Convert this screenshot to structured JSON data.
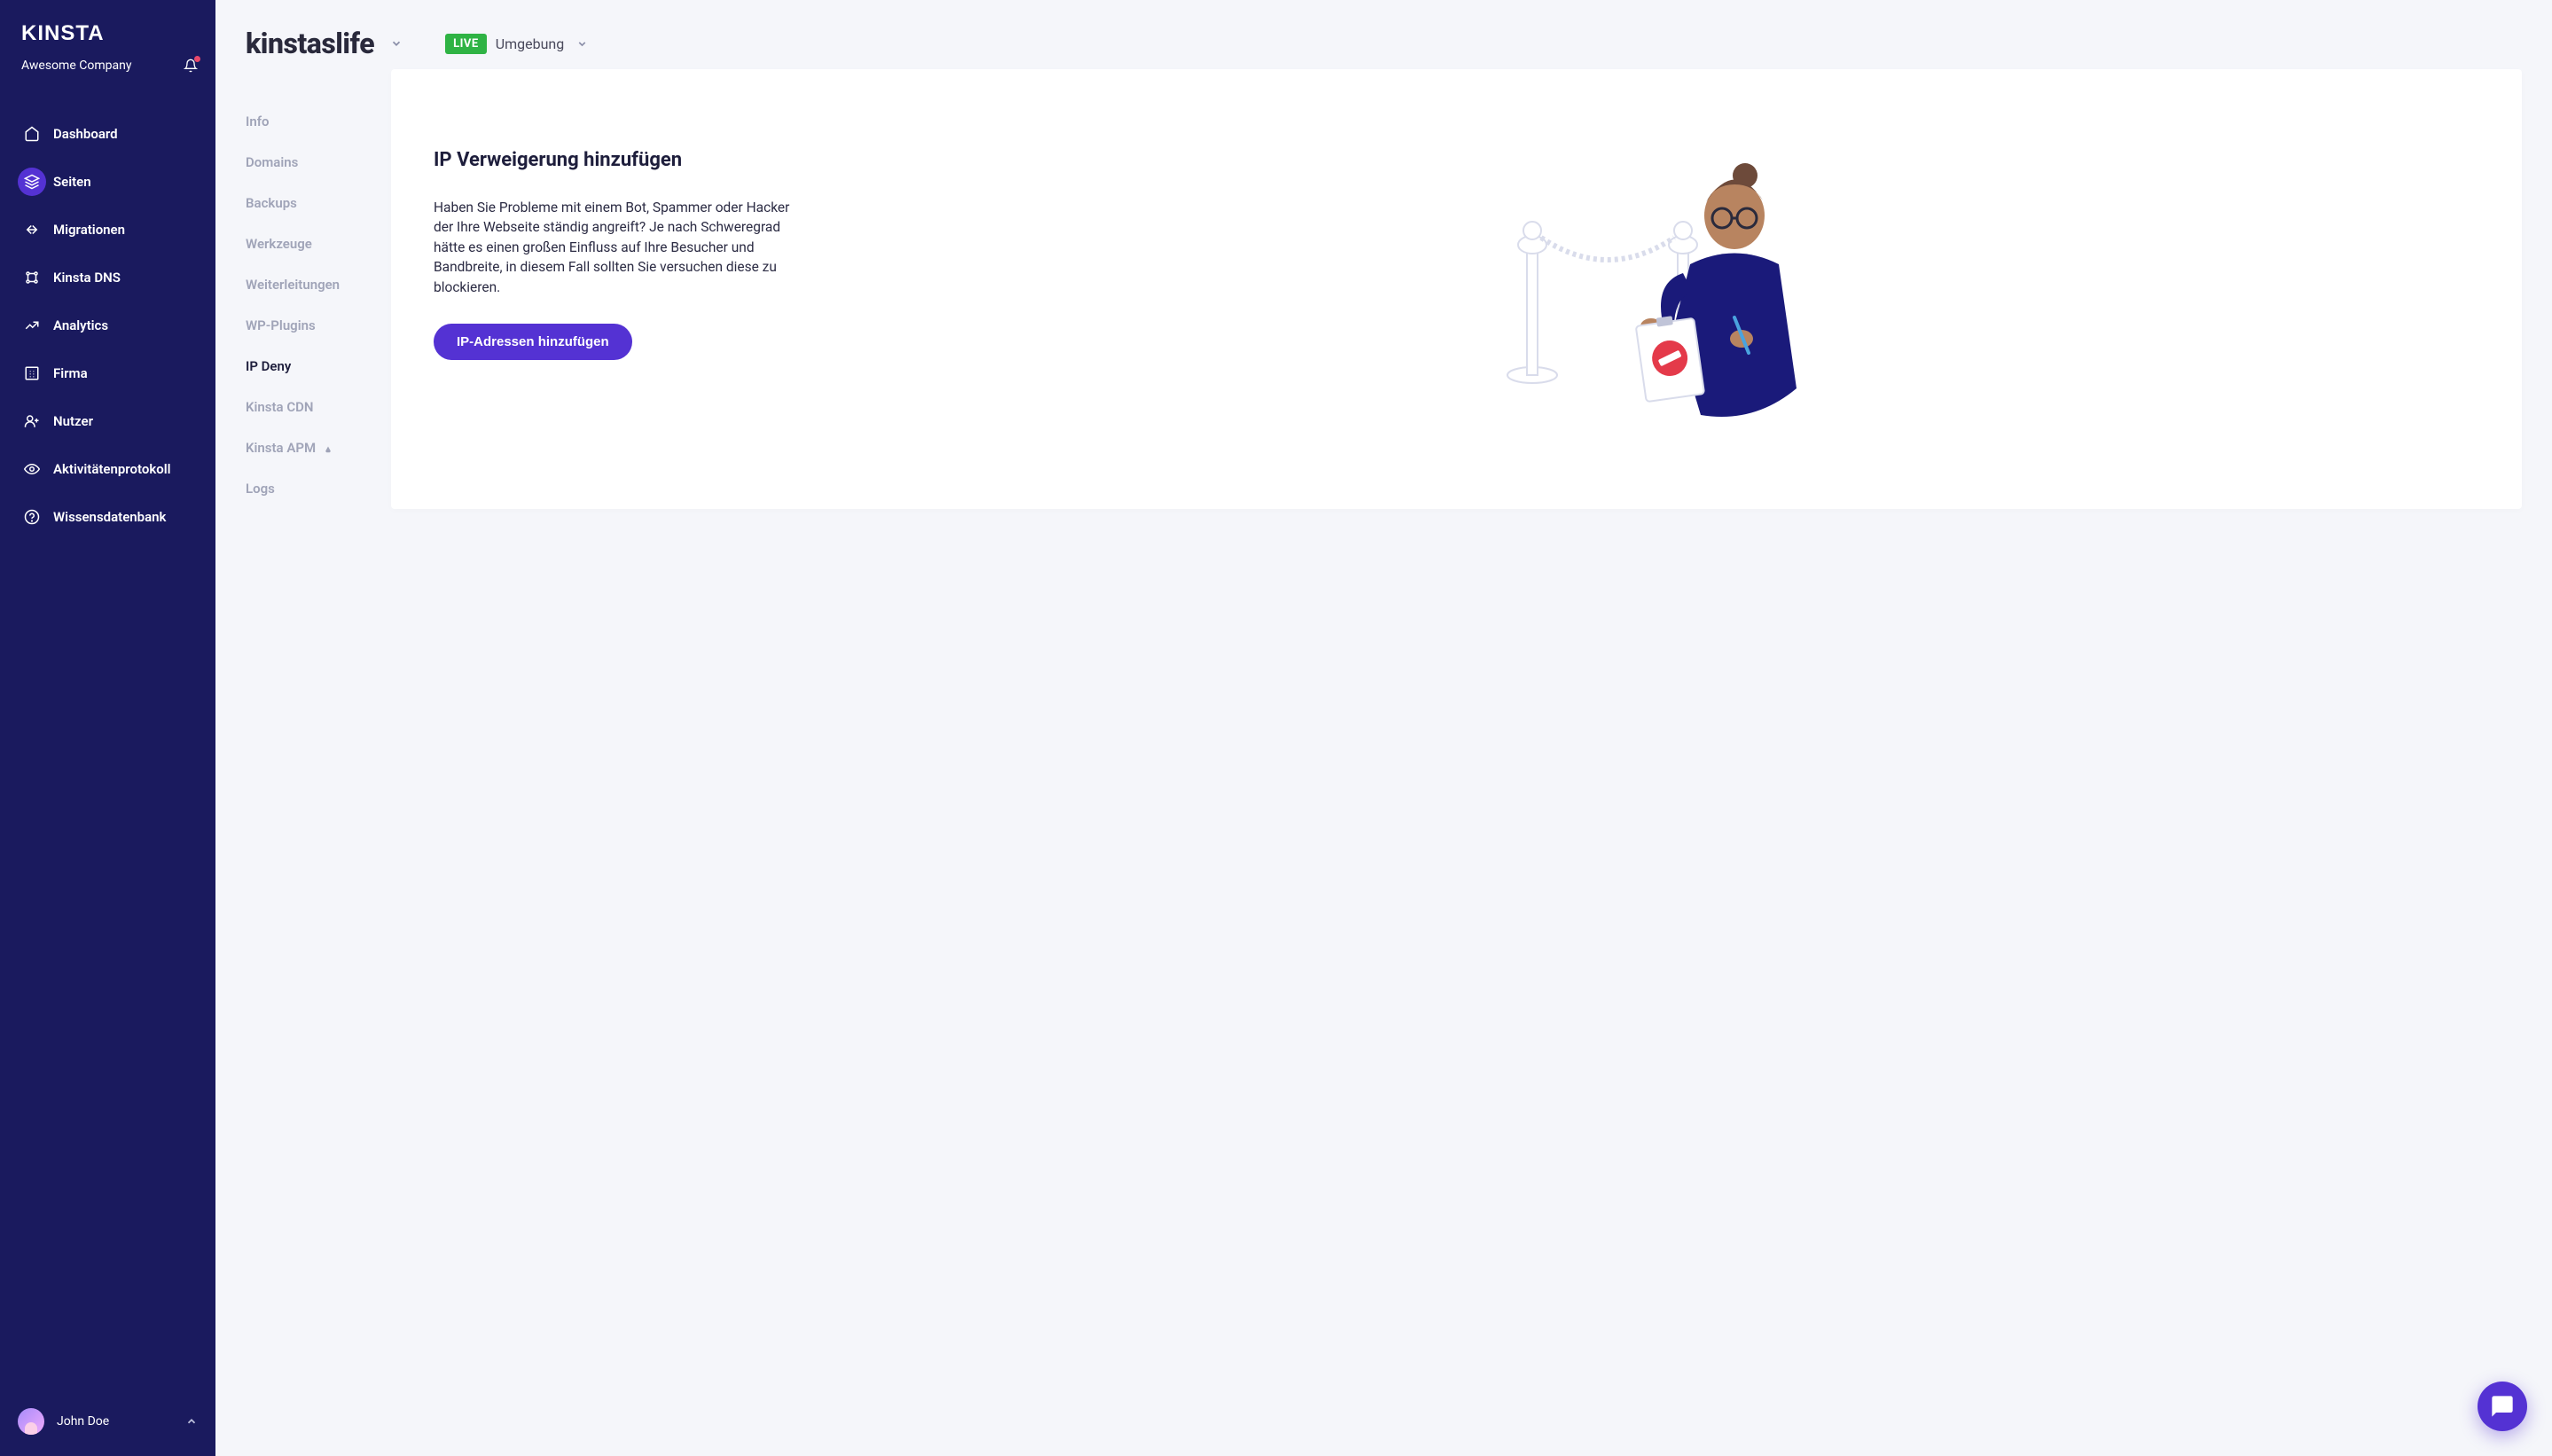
{
  "brand": "KINSTA",
  "company": "Awesome Company",
  "nav": {
    "items": [
      {
        "id": "dashboard",
        "label": "Dashboard",
        "icon": "home"
      },
      {
        "id": "seiten",
        "label": "Seiten",
        "icon": "layers",
        "active": true
      },
      {
        "id": "migrationen",
        "label": "Migrationen",
        "icon": "migrate"
      },
      {
        "id": "dns",
        "label": "Kinsta DNS",
        "icon": "dns"
      },
      {
        "id": "analytics",
        "label": "Analytics",
        "icon": "trend"
      },
      {
        "id": "firma",
        "label": "Firma",
        "icon": "company"
      },
      {
        "id": "nutzer",
        "label": "Nutzer",
        "icon": "user-plus"
      },
      {
        "id": "protokoll",
        "label": "Aktivitätenprotokoll",
        "icon": "eye"
      },
      {
        "id": "wissen",
        "label": "Wissensdatenbank",
        "icon": "help"
      }
    ]
  },
  "user": {
    "name": "John Doe"
  },
  "header": {
    "site": "kinstaslife",
    "env_badge": "LIVE",
    "env_label": "Umgebung"
  },
  "subnav": {
    "items": [
      {
        "id": "info",
        "label": "Info"
      },
      {
        "id": "domains",
        "label": "Domains"
      },
      {
        "id": "backups",
        "label": "Backups"
      },
      {
        "id": "werkzeuge",
        "label": "Werkzeuge"
      },
      {
        "id": "weiterleitungen",
        "label": "Weiterleitungen"
      },
      {
        "id": "wpplugins",
        "label": "WP-Plugins"
      },
      {
        "id": "ipdeny",
        "label": "IP Deny",
        "active": true
      },
      {
        "id": "cdn",
        "label": "Kinsta CDN"
      },
      {
        "id": "apm",
        "label": "Kinsta APM",
        "flag": true
      },
      {
        "id": "logs",
        "label": "Logs"
      }
    ]
  },
  "panel": {
    "title": "IP Verweigerung hinzufügen",
    "body": "Haben Sie Probleme mit einem Bot, Spammer oder Hacker der Ihre Webseite ständig angreift? Je nach Schweregrad hätte es einen großen Einfluss auf Ihre Besucher und Bandbreite, in diesem Fall sollten Sie versuchen diese zu blockieren.",
    "button": "IP-Adressen hinzufügen"
  },
  "colors": {
    "sidebar_bg": "#1a1a5e",
    "accent": "#5432d3",
    "live_green": "#2fb344"
  }
}
